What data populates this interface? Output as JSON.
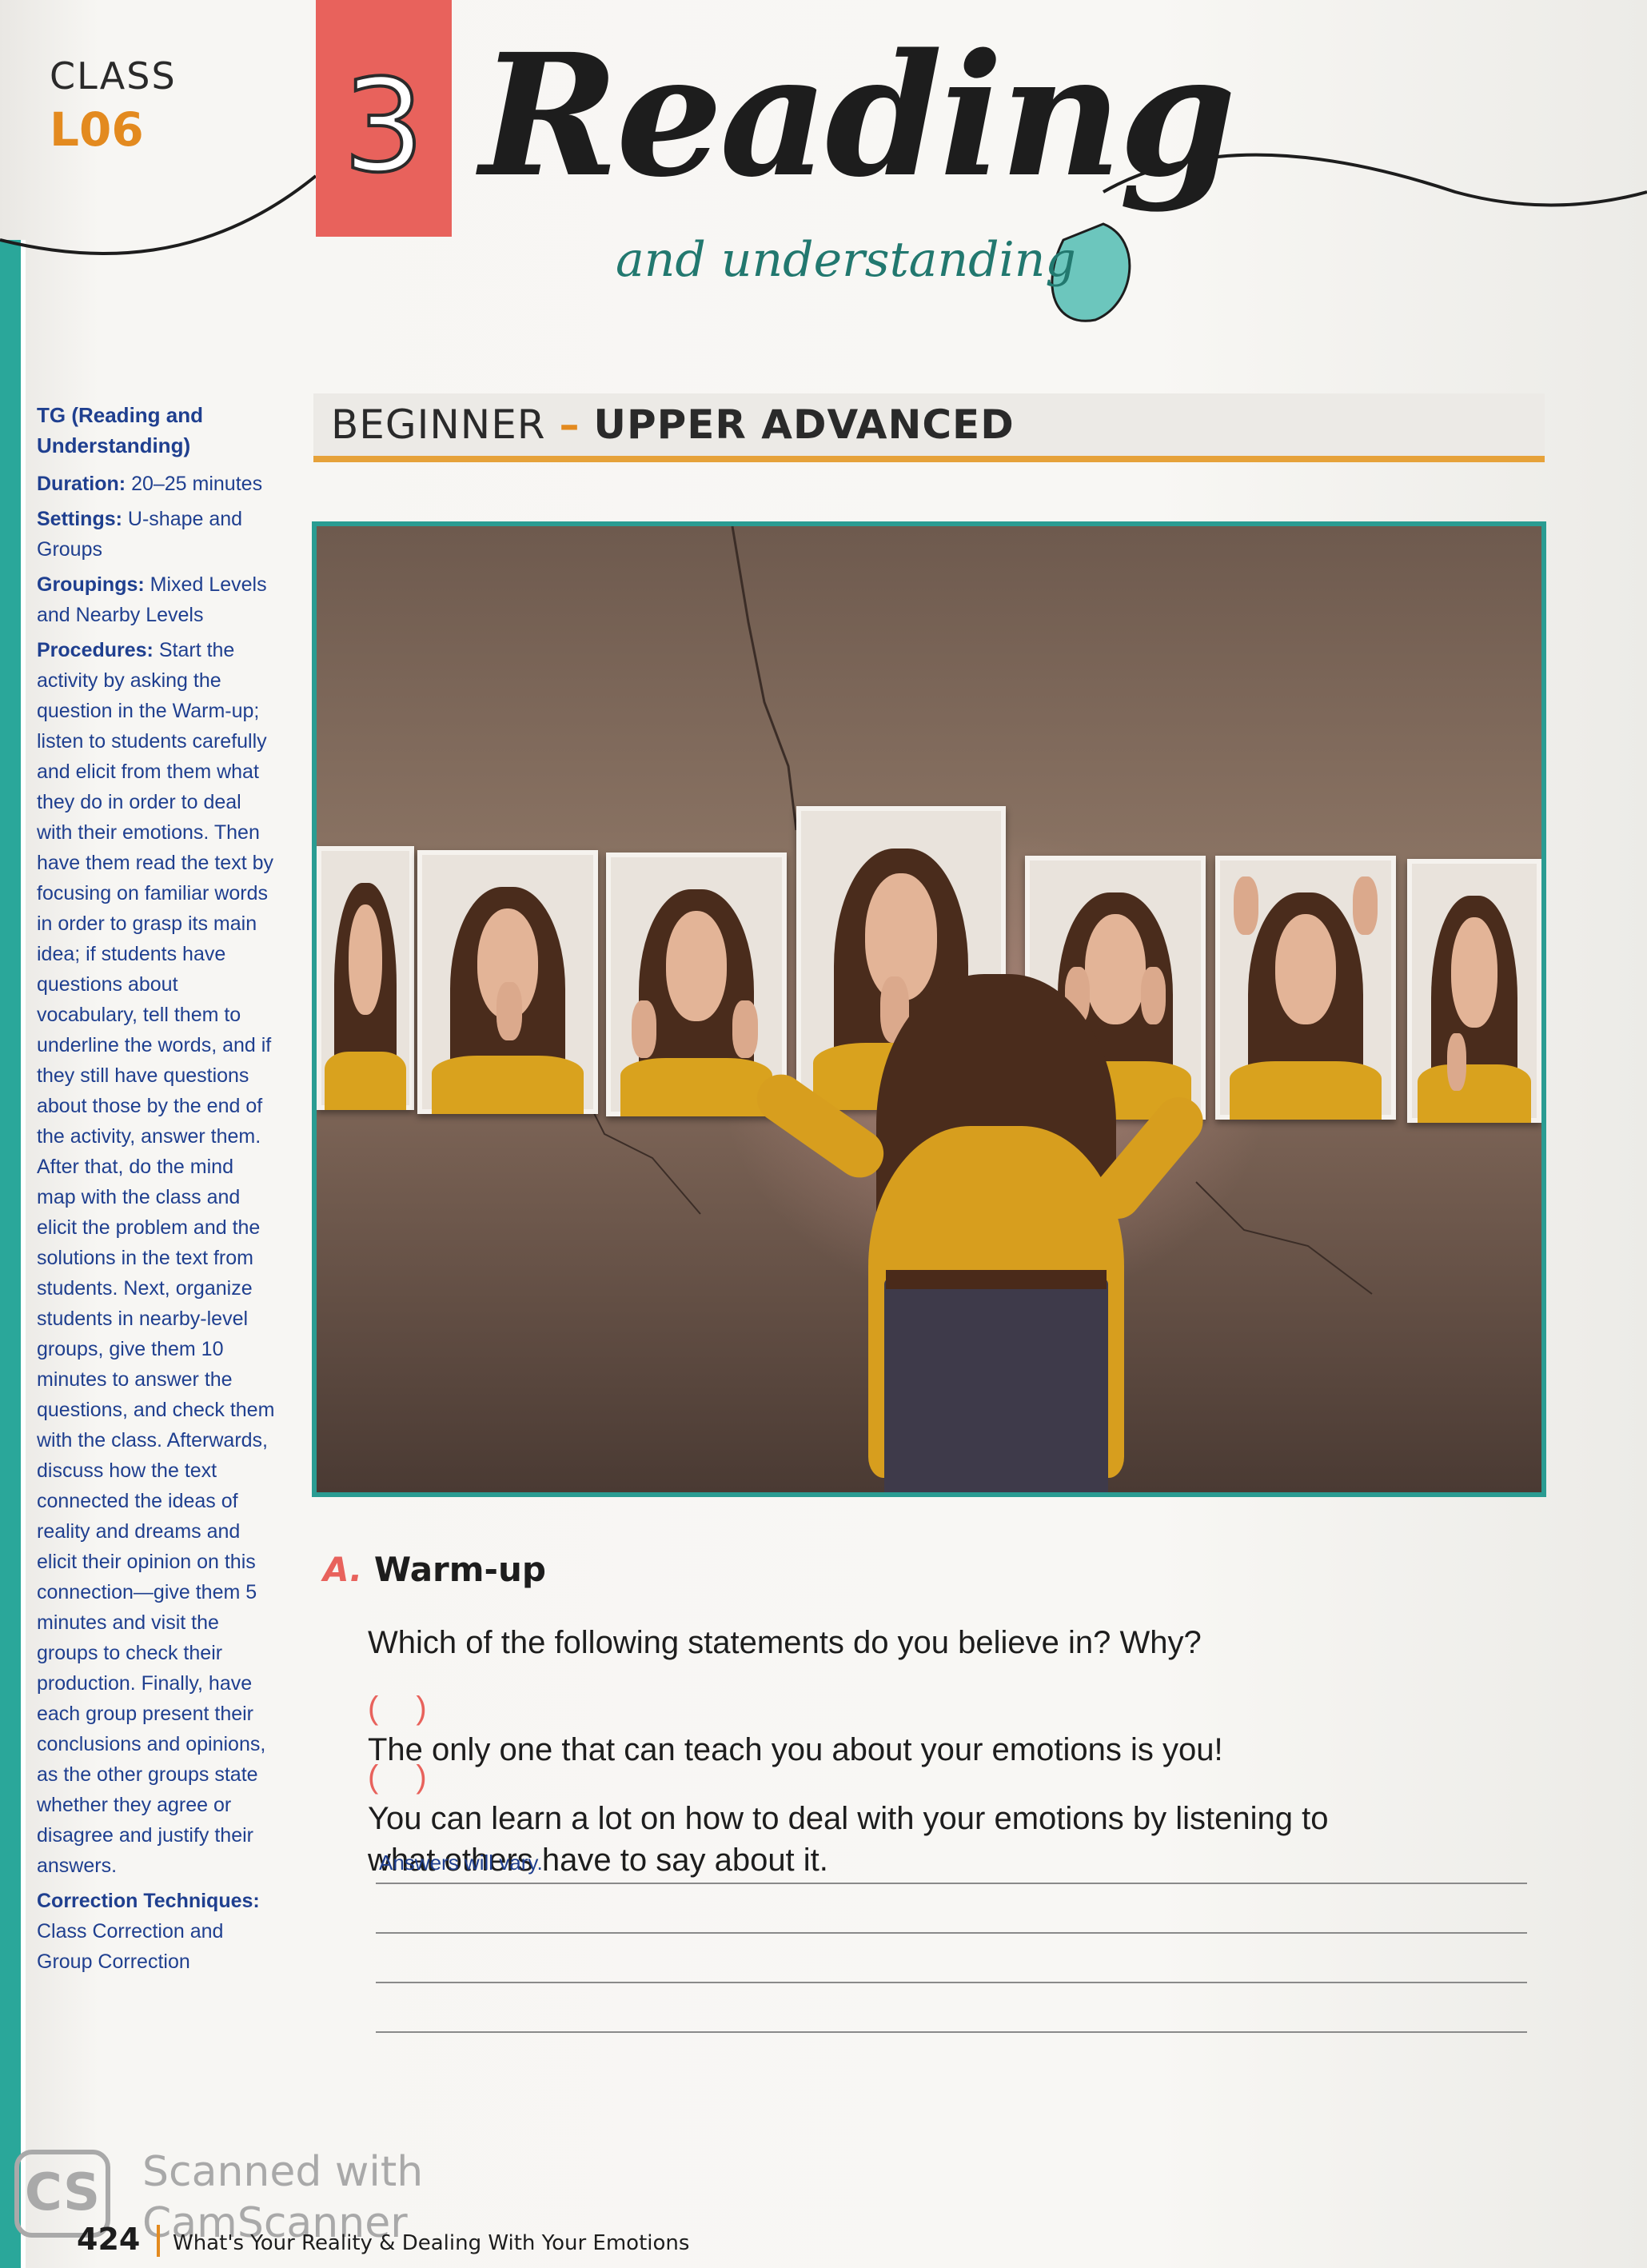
{
  "header": {
    "class_label": "CLASS",
    "class_code": "L06",
    "chapter_number": "3",
    "title": "Reading",
    "subtitle": "and understanding"
  },
  "level": {
    "from": "BEGINNER",
    "separator": "–",
    "to": "UPPER ADVANCED"
  },
  "sidebar": {
    "title": "TG (Reading and Understanding)",
    "duration_label": "Duration:",
    "duration_value": "20–25 minutes",
    "settings_label": "Settings:",
    "settings_value": "U-shape and Groups",
    "groupings_label": "Groupings:",
    "groupings_value": "Mixed Levels and Nearby Levels",
    "procedures_label": "Procedures:",
    "procedures_value": "Start the activity by asking the question in the Warm-up; listen to students carefully and elicit from them what they do in order to deal with their emotions. Then have them read the text by focusing on familiar words in order to grasp its main idea; if students have questions about vocabulary, tell them to underline the words, and if they still have questions about those by the end of the activity, answer them. After that, do the mind map with the class and elicit the problem and the solutions in the text from students. Next, organize students in nearby-level groups, give them 10 minutes to answer the questions, and check them with the class. Afterwards, discuss how the text connected the ideas of reality and dreams and elicit their opinion on this connection—give them 5 minutes and visit the groups to check their production. Finally, have each group present their conclusions and opinions, as the other groups state whether they agree or disagree and justify their answers.",
    "correction_label": "Correction Techniques:",
    "correction_value": "Class Correction and Group Correction"
  },
  "warmup": {
    "letter": "A.",
    "heading": "Warm-up",
    "question": "Which of the following statements do you believe in? Why?",
    "options": [
      {
        "paren": "( )",
        "text": "The only one that can teach you about your emotions is you!"
      },
      {
        "paren": "( )",
        "text": "You can learn a lot on how to deal with your emotions by listening to what others have to say about it."
      }
    ],
    "answer_hint": "Answers will vary."
  },
  "footer": {
    "page_number": "424",
    "running_title": "What's Your Reality & Dealing With Your Emotions"
  },
  "watermark": {
    "logo": "CS",
    "text": "Scanned with CamScanner"
  },
  "colors": {
    "accent_red": "#e8625c",
    "accent_orange": "#e38a1f",
    "teal": "#2a9c92",
    "sidebar_blue": "#1f3f8f"
  }
}
